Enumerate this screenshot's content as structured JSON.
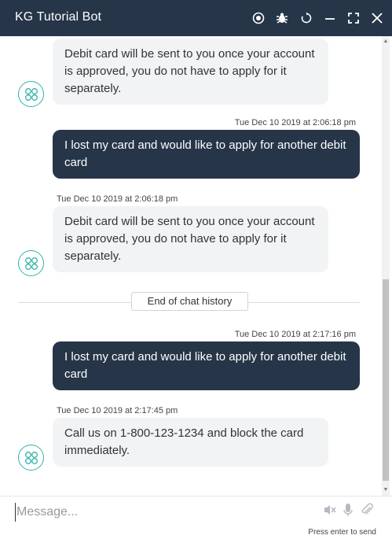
{
  "header": {
    "title": "KG Tutorial Bot",
    "icons": [
      "record-icon",
      "bug-icon",
      "refresh-icon",
      "minimize-icon",
      "expand-icon",
      "close-icon"
    ]
  },
  "messages": [
    {
      "from": "bot",
      "timestamp": "",
      "text": "Debit card will be sent to you once your account is approved, you do not have to apply for it separately."
    },
    {
      "from": "user",
      "timestamp": "Tue Dec 10 2019 at 2:06:18 pm",
      "text": "I lost my card and would like to apply for another debit card"
    },
    {
      "from": "bot",
      "timestamp": "Tue Dec 10 2019 at 2:06:18 pm",
      "text": "Debit card will be sent to you once your account is approved, you do not have to apply for it separately."
    },
    {
      "from": "user",
      "timestamp": "Tue Dec 10 2019 at 2:17:16 pm",
      "text": "I lost my card and would like to apply for another debit card"
    },
    {
      "from": "bot",
      "timestamp": "Tue Dec 10 2019 at 2:17:45 pm",
      "text": "Call us on 1-800-123-1234 and block the card immediately."
    }
  ],
  "history_divider": "End of chat history",
  "composer": {
    "placeholder": "Message...",
    "hint": "Press enter to send",
    "icons": [
      "speaker-muted-icon",
      "microphone-icon",
      "attachment-icon"
    ]
  },
  "colors": {
    "header_bg": "#263548",
    "user_bubble": "#263548",
    "bot_bubble": "#f2f3f5",
    "avatar_accent": "#2fb3a9"
  }
}
